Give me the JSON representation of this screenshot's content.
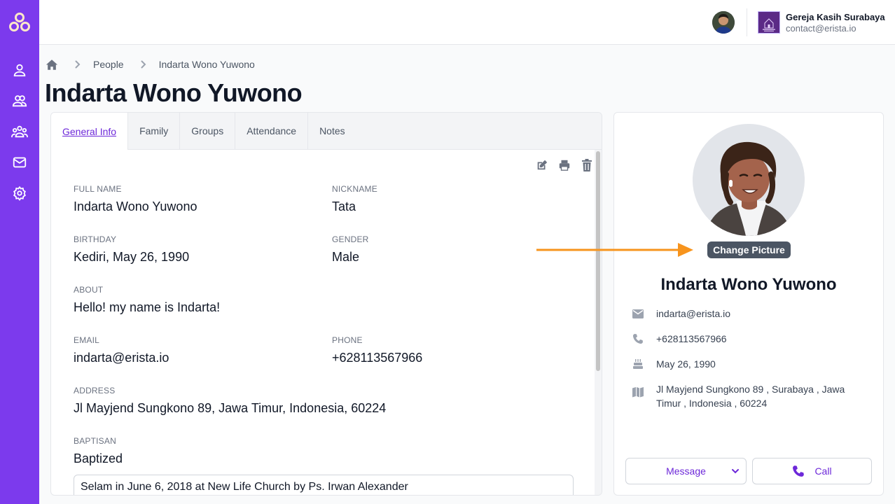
{
  "header": {
    "org_name": "Gereja Kasih Surabaya",
    "org_email": "contact@erista.io"
  },
  "sidebar": {
    "items": [
      {
        "name": "person-icon"
      },
      {
        "name": "people-icon"
      },
      {
        "name": "group-icon"
      },
      {
        "name": "mail-icon"
      },
      {
        "name": "settings-icon"
      }
    ],
    "accent": "#7c3aed"
  },
  "breadcrumb": {
    "items": [
      "People",
      "Indarta Wono Yuwono"
    ]
  },
  "page": {
    "title": "Indarta Wono Yuwono"
  },
  "tabs": [
    {
      "label": "General Info",
      "active": true
    },
    {
      "label": "Family",
      "active": false
    },
    {
      "label": "Groups",
      "active": false
    },
    {
      "label": "Attendance",
      "active": false
    },
    {
      "label": "Notes",
      "active": false
    }
  ],
  "general_info": {
    "full_name_label": "FULL NAME",
    "full_name": "Indarta Wono Yuwono",
    "nickname_label": "NICKNAME",
    "nickname": "Tata",
    "birthday_label": "BIRTHDAY",
    "birthday": "Kediri, May 26, 1990",
    "gender_label": "GENDER",
    "gender": "Male",
    "about_label": "ABOUT",
    "about": "Hello! my name is Indarta!",
    "email_label": "EMAIL",
    "email": "indarta@erista.io",
    "phone_label": "PHONE",
    "phone": "+628113567966",
    "address_label": "ADDRESS",
    "address": "Jl Mayjend Sungkono 89, Jawa Timur, Indonesia, 60224",
    "baptism_label": "BAPTISAN",
    "baptism": "Baptized",
    "baptism_note": "Selam in June 6, 2018 at New Life Church by Ps. Irwan Alexander"
  },
  "profile": {
    "change_picture_label": "Change Picture",
    "name": "Indarta Wono Yuwono",
    "email": "indarta@erista.io",
    "phone": "+628113567966",
    "birthday": "May 26, 1990",
    "address_line1": "Jl Mayjend Sungkono 89 , Surabaya , Jawa",
    "address_line2": "Timur , Indonesia , 60224",
    "message_label": "Message",
    "call_label": "Call"
  },
  "colors": {
    "primary": "#7c3aed",
    "annotation_arrow": "#f7941d"
  }
}
